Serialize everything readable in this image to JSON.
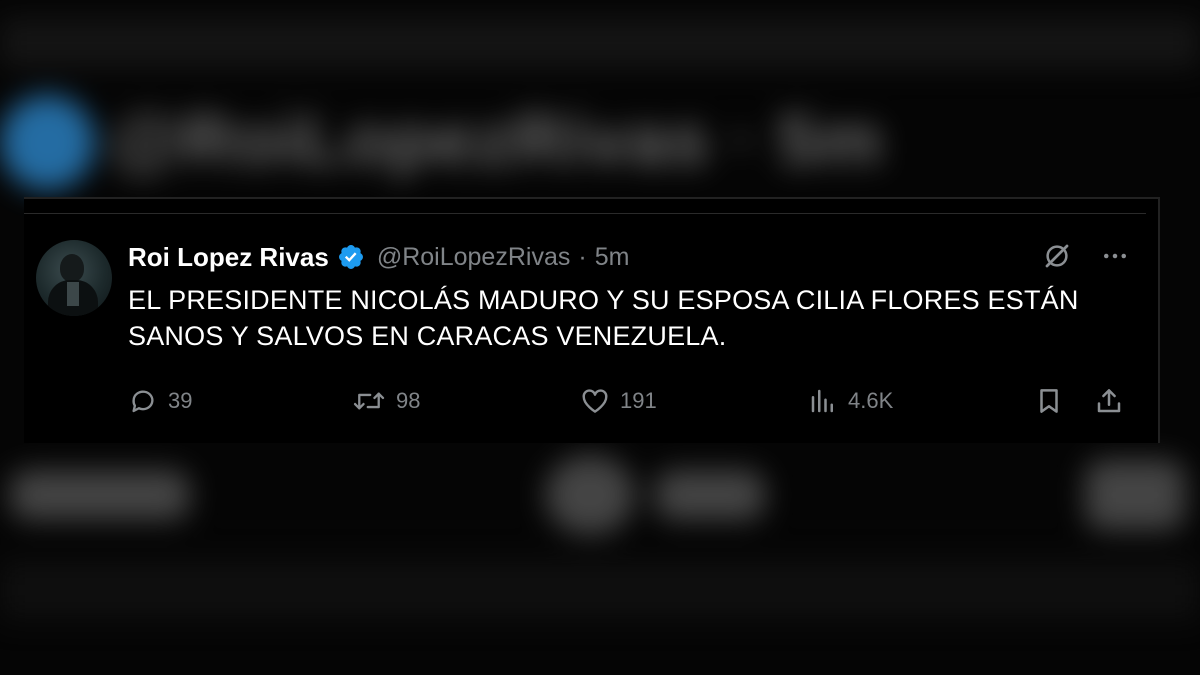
{
  "background": {
    "blurred_name": "@RoiLopezRivas · 5m"
  },
  "tweet": {
    "display_name": "Roi Lopez Rivas",
    "handle": "@RoiLopezRivas",
    "separator": "·",
    "time": "5m",
    "text": "EL PRESIDENTE NICOLÁS MADURO Y SU ESPOSA CILIA FLORES ESTÁN SANOS Y SALVOS EN CARACAS VENEZUELA.",
    "verified_color": "#1d9bf0",
    "icons": {
      "top": [
        "grok-icon",
        "more-icon"
      ],
      "actions": [
        "reply-icon",
        "retweet-icon",
        "like-icon",
        "views-icon",
        "bookmark-icon",
        "share-icon"
      ]
    },
    "stats": {
      "replies": "39",
      "retweets": "98",
      "likes": "191",
      "views": "4.6K"
    }
  }
}
